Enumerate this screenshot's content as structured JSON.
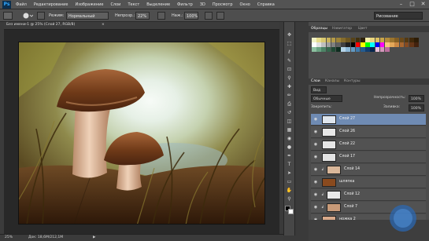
{
  "app": {
    "logo": "Ps",
    "menus": [
      "Файл",
      "Редактирование",
      "Изображение",
      "Слои",
      "Текст",
      "Выделение",
      "Фильтр",
      "3D",
      "Просмотр",
      "Окно",
      "Справка"
    ],
    "window_controls": [
      "–",
      "□",
      "✕"
    ]
  },
  "options": {
    "mode_label": "Режим:",
    "mode_value": "Нормальный",
    "opacity_label": "Непрозр.:",
    "opacity_value": "22%",
    "flow_label": "Наж.:",
    "flow_value": "100%",
    "workspace": "Рисование"
  },
  "document": {
    "tab_title": "Без имени-1 @ 25% (Слой 27, RGB/8)",
    "close": "×"
  },
  "status": {
    "zoom": "25%",
    "doc_info": "Док: 18,6М/212,1М"
  },
  "toolbox": {
    "icons": [
      "move-icon",
      "marquee-icon",
      "lasso-icon",
      "quick-select-icon",
      "crop-icon",
      "eyedropper-icon",
      "healing-icon",
      "brush-icon",
      "stamp-icon",
      "history-brush-icon",
      "eraser-icon",
      "gradient-icon",
      "blur-icon",
      "dodge-icon",
      "pen-icon",
      "type-icon",
      "path-select-icon",
      "shape-icon",
      "hand-icon",
      "zoom-icon"
    ],
    "glyphs": [
      "✥",
      "⬚",
      "ℓ",
      "✎",
      "⊡",
      "⚲",
      "✚",
      "✏",
      "⎙",
      "↺",
      "◫",
      "▦",
      "◉",
      "●",
      "✒",
      "T",
      "➤",
      "▭",
      "✋",
      "⚲"
    ]
  },
  "swatches_panel": {
    "tabs": [
      "Образцы",
      "Навигатор",
      "Цвет"
    ],
    "colors": [
      "#f2f2c4",
      "#e6dc8c",
      "#d9c870",
      "#c9b25a",
      "#b59b48",
      "#9c8238",
      "#846b2c",
      "#6d5621",
      "#574318",
      "#41310f",
      "#2e2109",
      "#f6eeaa",
      "#ead67e",
      "#dbbf60",
      "#c9a54a",
      "#b38c3a",
      "#9b742e",
      "#835e23",
      "#6b4a1a",
      "#543912",
      "#40290b",
      "#2d1c06",
      "#ffffff",
      "#e0e0e0",
      "#c0c0c0",
      "#a0a0a0",
      "#808080",
      "#606060",
      "#404040",
      "#202020",
      "#000000",
      "#ff0000",
      "#ffff00",
      "#00ff00",
      "#00ffff",
      "#0000ff",
      "#ff00ff",
      "#f5c97a",
      "#e3a85a",
      "#c98642",
      "#a8662f",
      "#854a21",
      "#633517",
      "#42220e",
      "#8cc0a0",
      "#6aa282",
      "#4d8466",
      "#35664c",
      "#1f4934",
      "#0f2d20",
      "#b5d4e8",
      "#8bb7d6",
      "#6299c2",
      "#3f7aac",
      "#245c90",
      "#123f70",
      "#06264f",
      "#e8c0d8",
      "#d496bb",
      "#bc6d9d"
    ]
  },
  "layers_panel": {
    "tabs": [
      "Слои",
      "Каналы",
      "Контуры"
    ],
    "kind_label": "Вид",
    "blend_mode": "Обычные",
    "opacity_label": "Непрозрачность:",
    "opacity_value": "100%",
    "lock_label": "Закрепить:",
    "fill_label": "Заливка:",
    "fill_value": "100%",
    "layers": [
      {
        "name": "Слой 27",
        "selected": true,
        "thumb": "#dfe6ee",
        "indent": false,
        "fx": false
      },
      {
        "name": "Слой 26",
        "selected": false,
        "thumb": "#e8e8e8",
        "indent": false,
        "fx": false
      },
      {
        "name": "Слой 22",
        "selected": false,
        "thumb": "#e6e6e6",
        "indent": false,
        "fx": false
      },
      {
        "name": "Слой 17",
        "selected": false,
        "thumb": "#e2e2e2",
        "indent": false,
        "fx": false
      },
      {
        "name": "Слой 14",
        "selected": false,
        "thumb": "#d9b79a",
        "indent": true,
        "fx": true
      },
      {
        "name": "шляпка",
        "selected": false,
        "thumb": "#8a4a1e",
        "indent": false,
        "fx": false
      },
      {
        "name": "Слой 12",
        "selected": false,
        "thumb": "#e9e9e9",
        "indent": true,
        "fx": true
      },
      {
        "name": "Слой 7",
        "selected": false,
        "thumb": "#c89a78",
        "indent": true,
        "fx": true
      },
      {
        "name": "ножка 2",
        "selected": false,
        "thumb": "#d8a98a",
        "indent": false,
        "fx": false
      }
    ]
  }
}
